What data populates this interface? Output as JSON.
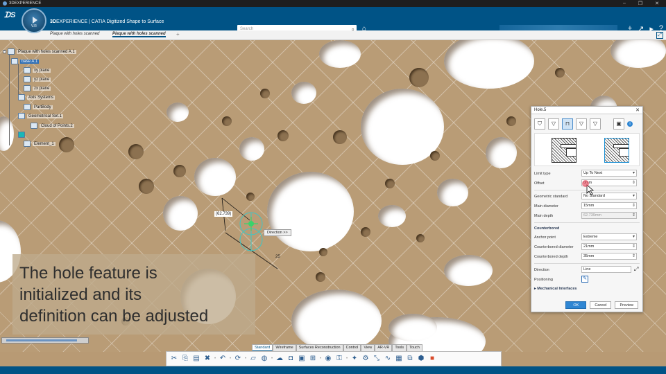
{
  "os": {
    "title": "3DEXPERIENCE",
    "controls": [
      "–",
      "❐",
      "✕"
    ]
  },
  "app": {
    "brand_prefix": "3D",
    "brand_title": "EXPERIENCE | CATIA",
    "app_name": "Digitized Shape to Surface",
    "compass_version": "V.R",
    "search_placeholder": "Search"
  },
  "tabs": [
    {
      "label": "Plaque with holes scanned"
    },
    {
      "label": "Plaque with holes scanned"
    }
  ],
  "tree": {
    "root": "Plaque with holes scanned A.1",
    "nodes": [
      "base A.1",
      "xy plane",
      "yz plane",
      "zx plane",
      "Axis Systems",
      "PartBody",
      "Geometrical Set.1",
      "Cloud of Points.2",
      "",
      "Element_1"
    ]
  },
  "viewport": {
    "dimension_value": "(62.739)",
    "dimension_small": "25",
    "direction_chip": "Direction >>"
  },
  "caption": {
    "lines": [
      "The hole feature is",
      "initialized and its",
      "definition can be adjusted"
    ]
  },
  "dialog": {
    "title": "Hole.5",
    "fields": {
      "limit_type": {
        "label": "Limit type",
        "value": "Up To Next"
      },
      "offset": {
        "label": "Offset",
        "value": "0mm"
      },
      "geometric_standard": {
        "label": "Geometric standard",
        "value": "No Standard"
      },
      "main_diameter": {
        "label": "Main diameter",
        "value": "15mm"
      },
      "main_depth": {
        "label": "Main depth",
        "value": "62.739mm"
      }
    },
    "counterbored": {
      "title": "Counterbored",
      "anchor_point": {
        "label": "Anchor point",
        "value": "Extreme"
      },
      "diameter": {
        "label": "Counterbored diameter",
        "value": "21mm"
      },
      "depth": {
        "label": "Counterbored depth",
        "value": "35mm"
      }
    },
    "direction": {
      "label": "Direction",
      "value": "Line"
    },
    "positioning": {
      "label": "Positioning"
    },
    "mechanical": "Mechanical Interfaces",
    "buttons": {
      "ok": "OK",
      "cancel": "Cancel",
      "preview": "Preview"
    }
  },
  "section_tabs": [
    "Standard",
    "Wireframe",
    "Surfaces Reconstruction",
    "Control",
    "View",
    "AR-VR",
    "Tools",
    "Touch"
  ],
  "toolbar_icons": [
    "scissors-icon",
    "copy-icon",
    "paste-icon",
    "delete-icon",
    "undo-icon",
    "update-icon",
    "plane-icon",
    "sphere-icon",
    "cloud-icon",
    "hole-icon",
    "pad-icon",
    "mesh-icon",
    "scan-icon",
    "lock-icon",
    "cut-icon",
    "measure-icon",
    "axis-icon",
    "curve-icon",
    "surface-icon",
    "analysis-icon",
    "render-icon"
  ]
}
